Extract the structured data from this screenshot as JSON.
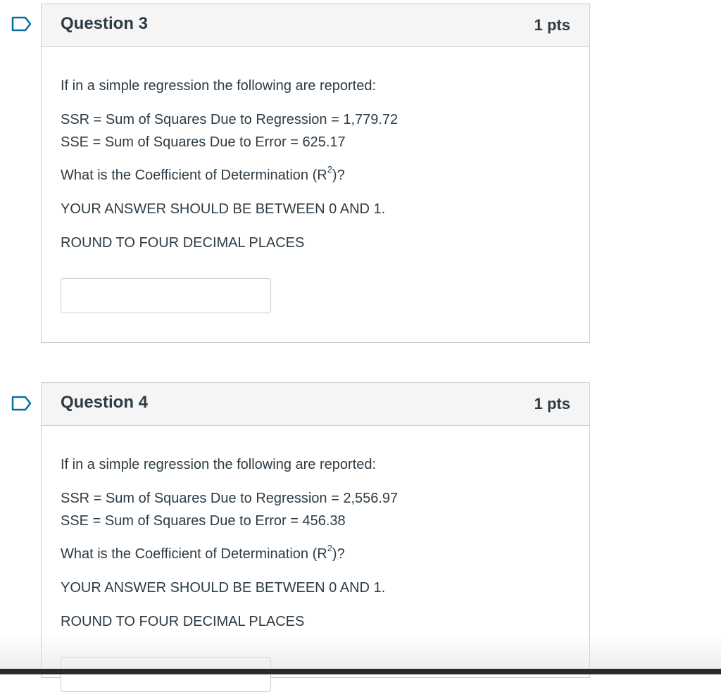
{
  "questions": [
    {
      "title": "Question 3",
      "points": "1 pts",
      "intro": "If in a simple regression the following are reported:",
      "ssr": "SSR = Sum of Squares Due to Regression = 1,779.72",
      "sse": "SSE = Sum of Squares Due to Error = 625.17",
      "question_prefix": "What is the Coefficient of Determination (R",
      "question_sup": "2",
      "question_suffix": ")?",
      "range_note": "YOUR ANSWER SHOULD BE BETWEEN 0 AND 1.",
      "rounding_note": "ROUND TO FOUR DECIMAL PLACES",
      "answer_value": ""
    },
    {
      "title": "Question 4",
      "points": "1 pts",
      "intro": "If in a simple regression the following are reported:",
      "ssr": "SSR = Sum of Squares Due to Regression = 2,556.97",
      "sse": "SSE = Sum of Squares Due to Error = 456.38",
      "question_prefix": "What is the Coefficient of Determination (R",
      "question_sup": "2",
      "question_suffix": ")?",
      "range_note": "YOUR ANSWER SHOULD BE BETWEEN 0 AND 1.",
      "rounding_note": "ROUND TO FOUR DECIMAL PLACES",
      "answer_value": ""
    }
  ],
  "icons": {
    "flag": "flag-outline-icon"
  },
  "colors": {
    "text": "#2d3b45",
    "border": "#c7cdd1",
    "header_bg": "#f5f5f5",
    "flag": "#0770a3"
  }
}
